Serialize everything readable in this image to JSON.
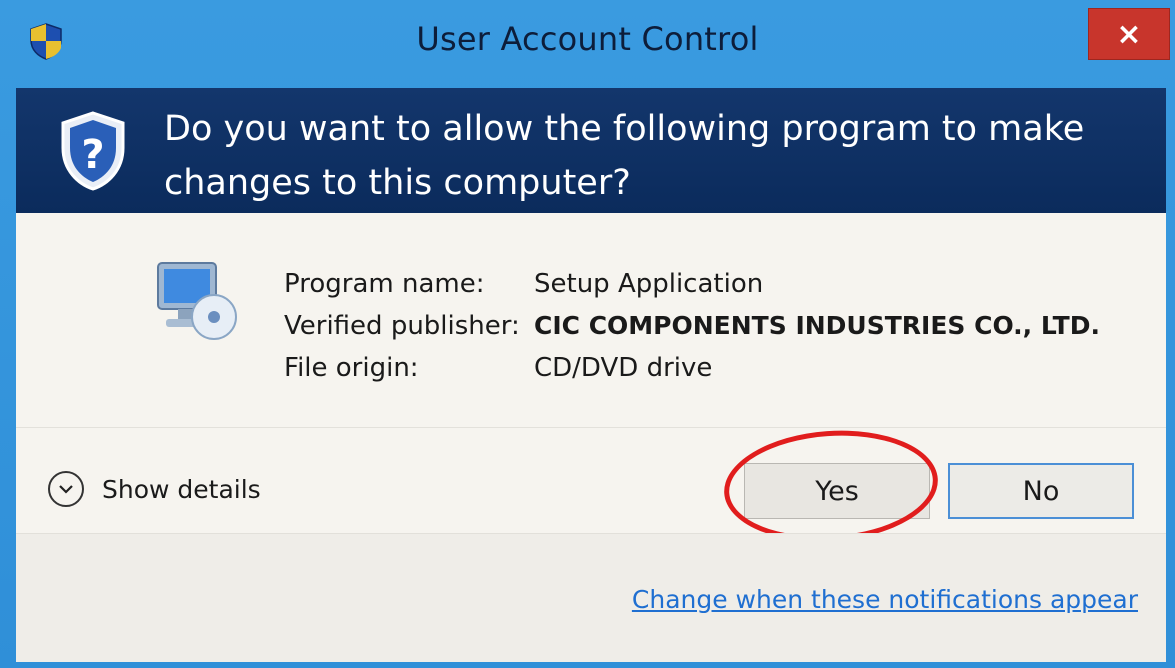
{
  "window": {
    "title": "User Account Control",
    "close_label": "×"
  },
  "header": {
    "question": "Do you want to allow the following program to make changes to this computer?"
  },
  "program_info": {
    "rows": [
      {
        "label": "Program name:",
        "value": "Setup Application"
      },
      {
        "label": "Verified publisher:",
        "value": "CIC COMPONENTS INDUSTRIES CO., LTD."
      },
      {
        "label": "File origin:",
        "value": "CD/DVD drive"
      }
    ]
  },
  "actions": {
    "show_details": "Show details",
    "yes": "Yes",
    "no": "No"
  },
  "footer": {
    "link": "Change when these notifications appear"
  },
  "icons": [
    "uac-shield-icon",
    "close-icon",
    "shield-question-icon",
    "monitor-cd-icon",
    "chevron-down-icon"
  ],
  "colors": {
    "header_bg": "#0b2b5c",
    "frame": "#2f8fd8",
    "close_btn": "#c8352c",
    "highlight_ring": "#e11d1d",
    "link": "#1f6fd1"
  }
}
